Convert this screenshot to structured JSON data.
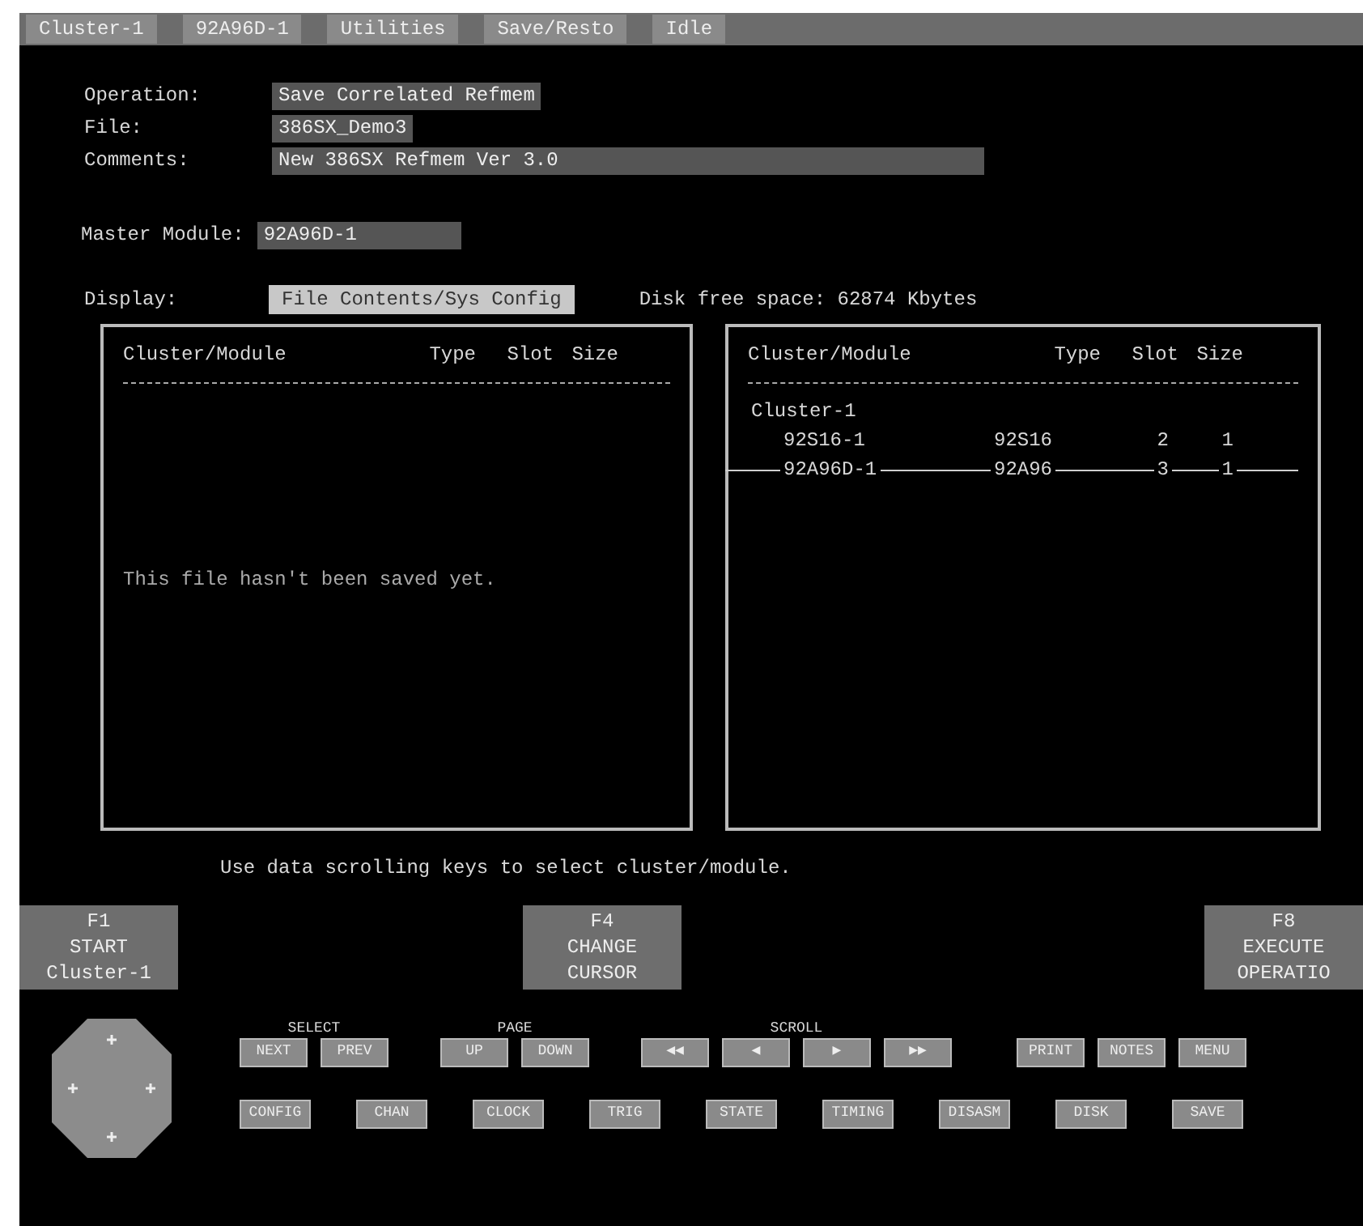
{
  "status_bar": [
    {
      "text": "Cluster-1"
    },
    {
      "text": "92A96D-1"
    },
    {
      "text": "Utilities"
    },
    {
      "text": "Save/Resto"
    },
    {
      "text": "Idle"
    }
  ],
  "fields": [
    {
      "label": "Operation:",
      "value": "Save Correlated Refmem"
    },
    {
      "label": "File:",
      "value": "386SX_Demo3"
    },
    {
      "label": "Comments:",
      "value": "New 386SX Refmem Ver 3.0"
    }
  ],
  "master_module": {
    "label": "Master Module:",
    "value": "92A96D-1"
  },
  "display": {
    "label": "Display:",
    "value": "File Contents/Sys Config",
    "disk_free": "Disk free space: 62874 Kbytes"
  },
  "left_panel": {
    "columns": [
      "Cluster/Module",
      "Type",
      "Slot",
      "Size"
    ],
    "message": "This file hasn't been saved yet."
  },
  "right_panel": {
    "columns": [
      "Cluster/Module",
      "Type",
      "Slot",
      "Size"
    ],
    "rows": [
      {
        "cells": [
          "Cluster-1"
        ],
        "indented": false,
        "cursor": false
      },
      {
        "cells": [
          "92S16-1",
          "92S16",
          "2",
          "1"
        ],
        "indented": true,
        "cursor": false
      },
      {
        "cells": [
          "92A96D-1",
          "92A96",
          "3",
          "1"
        ],
        "indented": true,
        "cursor": true
      }
    ]
  },
  "hint": "Use data scrolling keys to select cluster/module.",
  "function_keys": [
    {
      "key": "F1",
      "lines": [
        "START",
        "Cluster-1"
      ]
    },
    {
      "key": "F4",
      "lines": [
        "CHANGE",
        "CURSOR"
      ]
    },
    {
      "key": "F8",
      "lines": [
        "EXECUTE",
        "OPERATIO"
      ]
    }
  ],
  "key_groups": [
    {
      "label": "SELECT",
      "keys": [
        "NEXT",
        "PREV"
      ]
    },
    {
      "label": "PAGE",
      "keys": [
        "UP",
        "DOWN"
      ]
    },
    {
      "label": "SCROLL",
      "keys": [
        "◀◀",
        "◀",
        "▶",
        "▶▶"
      ]
    },
    {
      "keys": [
        "PRINT",
        "NOTES",
        "MENU"
      ]
    }
  ],
  "menu_keys": [
    "CONFIG",
    "CHAN",
    "CLOCK",
    "TRIG",
    "STATE",
    "TIMING",
    "DISASM",
    "DISK",
    "SAVE"
  ]
}
